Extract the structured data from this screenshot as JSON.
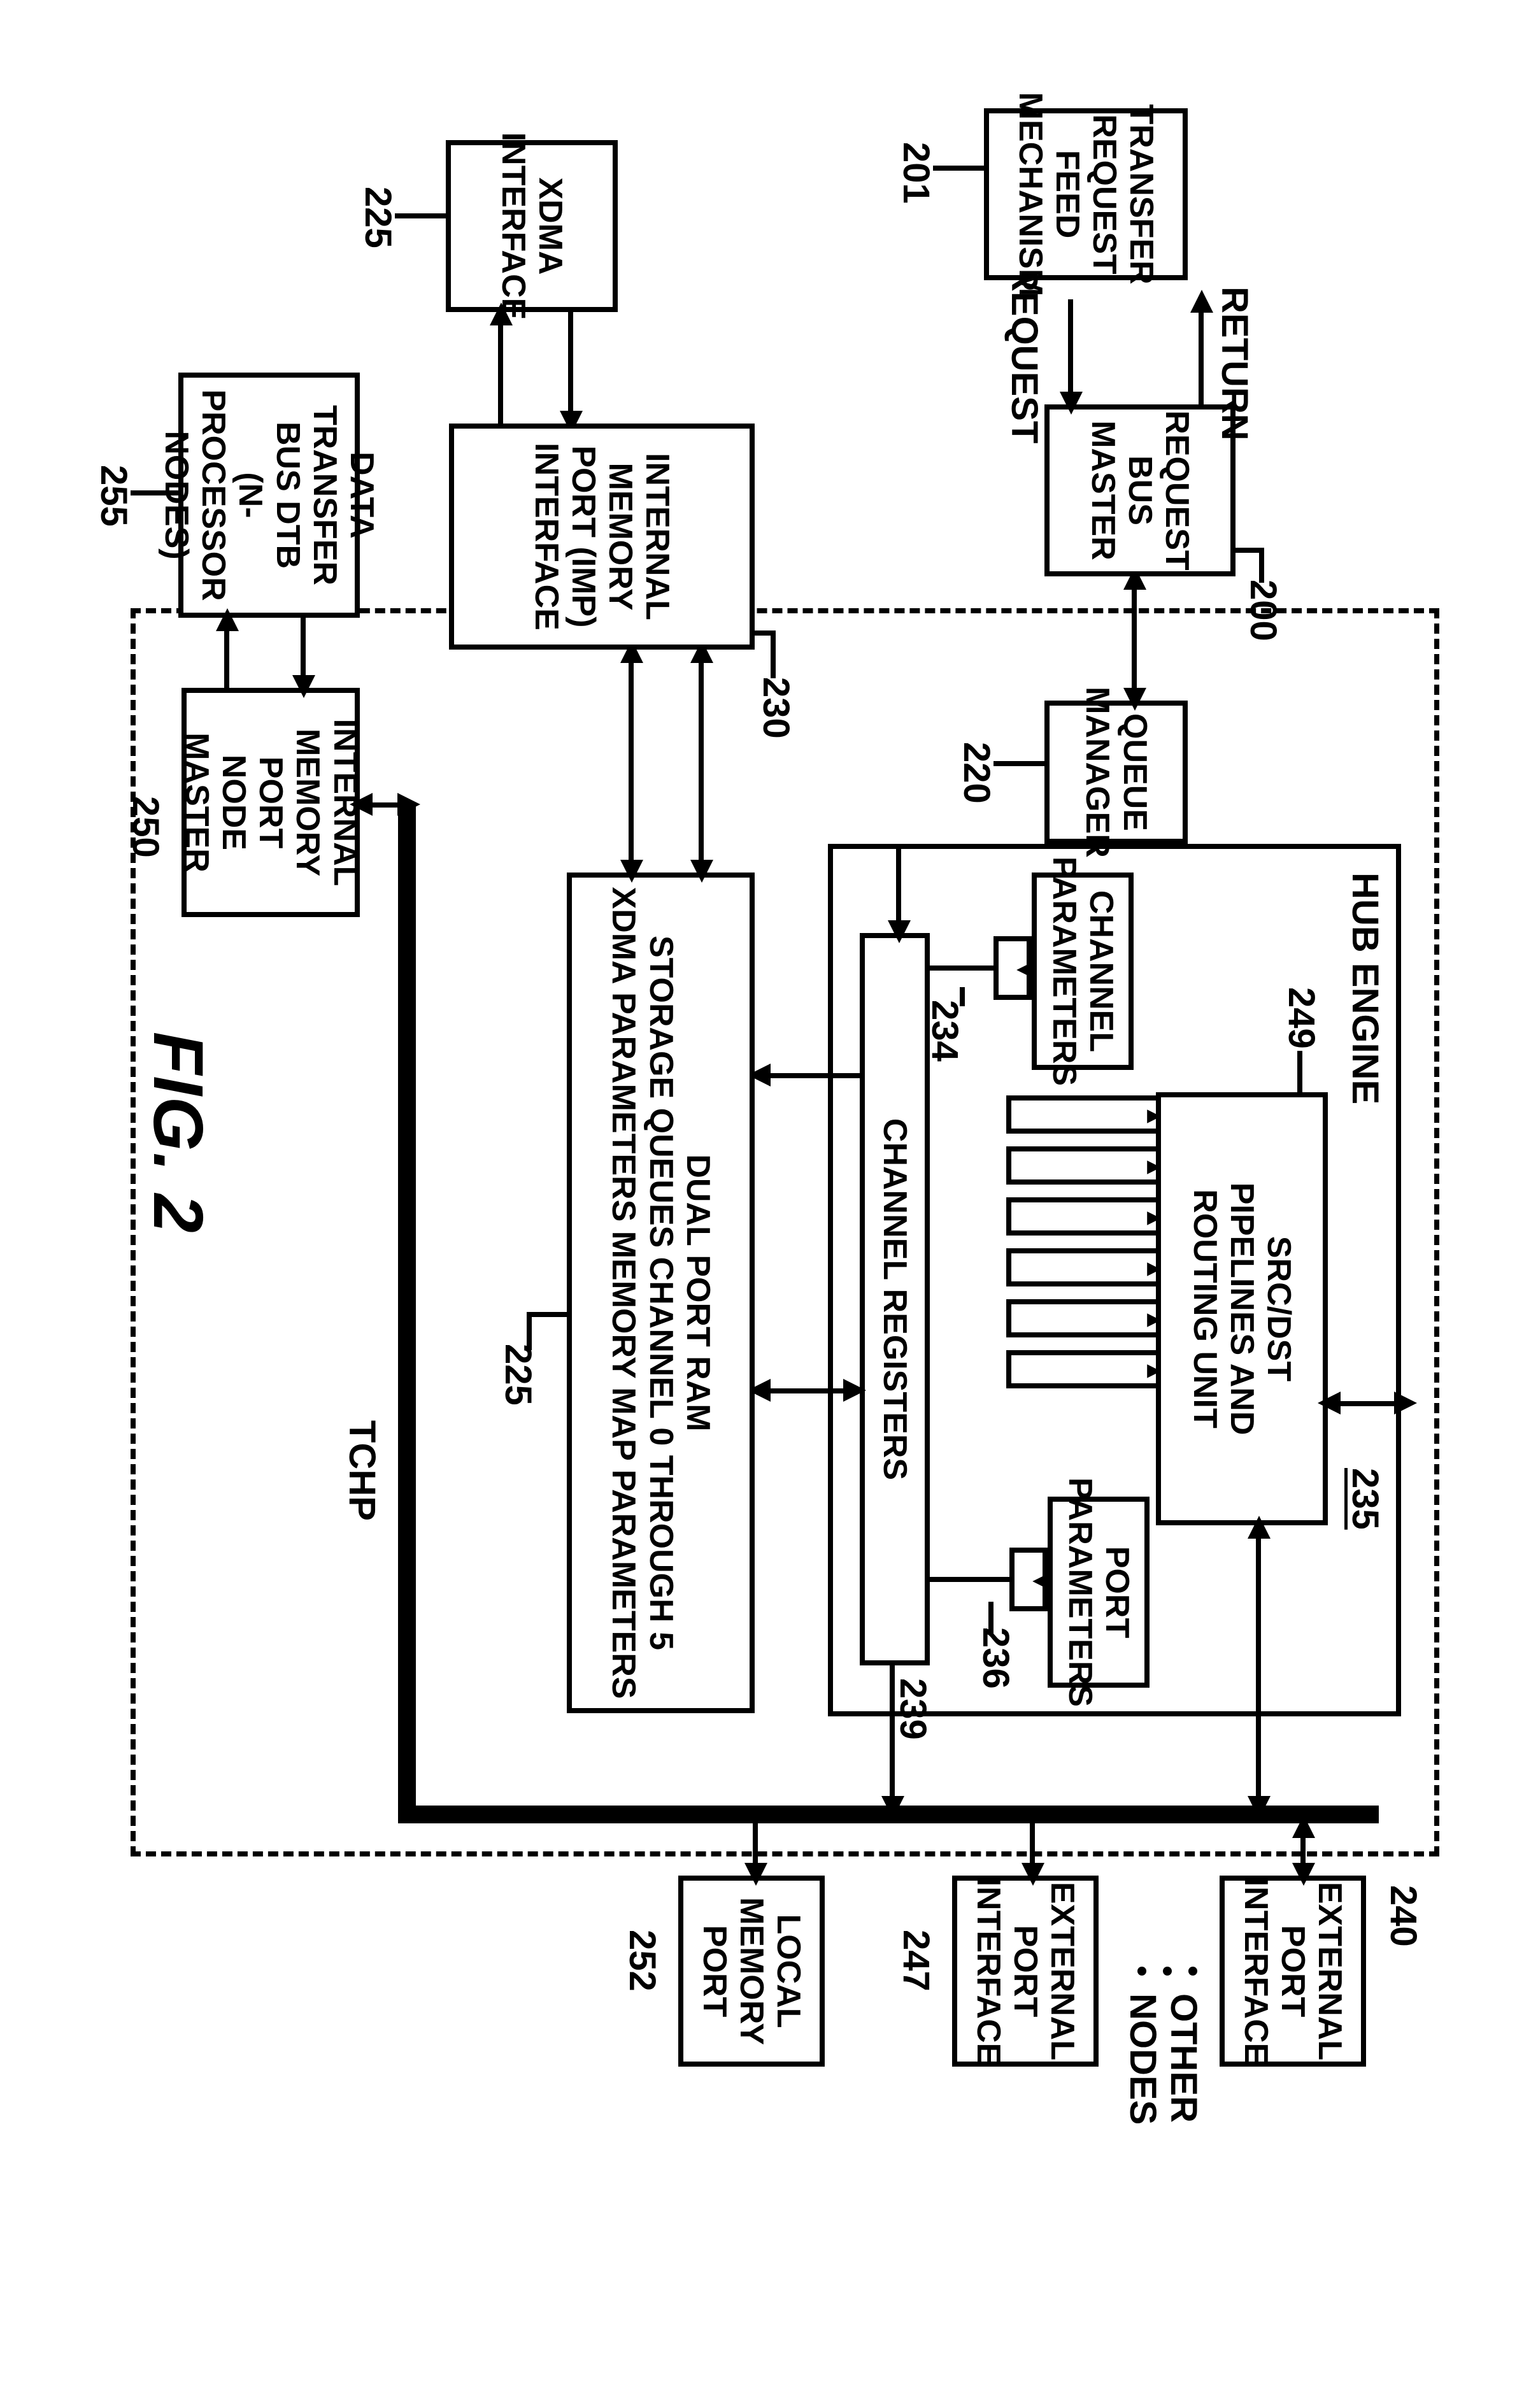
{
  "figure": "FIG. 2",
  "tchp_label": "TCHP",
  "other_nodes_label": "OTHER\nNODES",
  "return_label": "RETURN",
  "request_label": "REQUEST",
  "hub": {
    "title": "HUB ENGINE",
    "ref": "235",
    "channel_parameters": "CHANNEL\nPARAMETERS",
    "channel_parameters_ref": "234",
    "pipelines": "SRC/DST\nPIPELINES AND\nROUTING UNIT",
    "pipelines_ref": "249",
    "port_parameters": "PORT\nPARAMETERS",
    "port_parameters_ref": "236",
    "channel_registers": "CHANNEL REGISTERS",
    "channel_registers_ref": "239"
  },
  "blocks": {
    "transfer_mech": {
      "text": "TRANSFER\nREQUEST FEED\nMECHANISM",
      "ref": "201"
    },
    "request_bus_master": {
      "text": "REQUEST\nBUS\nMASTER",
      "ref": "200"
    },
    "queue_manager": {
      "text": "QUEUE\nMANAGER",
      "ref": "220"
    },
    "dualport_ram": {
      "text": "DUAL PORT RAM\nSTORAGE QUEUES CHANNEL 0 THROUGH 5\nXDMA PARAMETERS MEMORY MAP PARAMETERS",
      "ref": "225"
    },
    "xdma_iface": {
      "text": "XDMA\nINTERFACE",
      "ref": "225"
    },
    "imp_iface": {
      "text": "INTERNAL\nMEMORY\nPORT (IMP)\nINTERFACE",
      "ref": "230"
    },
    "imp_master": {
      "text": "INTERNAL\nMEMORY PORT\nNODE MASTER",
      "ref": "250"
    },
    "dtb": {
      "text": "DATA TRANSFER\nBUS DTB\n(N-PROCESSOR\nNODES)",
      "ref": "255"
    },
    "ext_port_1": {
      "text": "EXTERNAL\nPORT\nINTERFACE",
      "ref": "240"
    },
    "ext_port_n": {
      "text": "EXTERNAL\nPORT\nINTERFACE",
      "ref": "247"
    },
    "local_mem": {
      "text": "LOCAL\nMEMORY\nPORT",
      "ref": "252"
    }
  }
}
